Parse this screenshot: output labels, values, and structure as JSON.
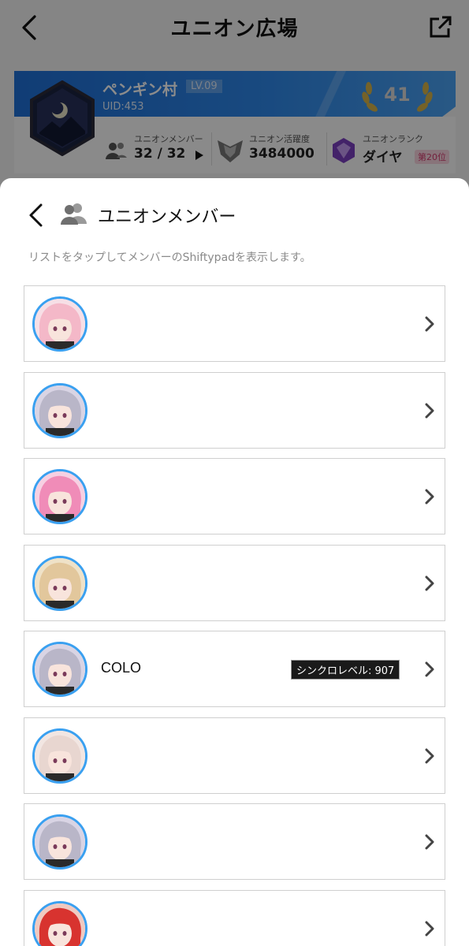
{
  "background_page": {
    "title": "ユニオン広場",
    "union": {
      "name": "ペンギン村",
      "level": "LV.09",
      "uid": "UID:453",
      "laurel_number": "41",
      "members_label": "ユニオンメンバー",
      "members_value": "32 / 32",
      "activity_label": "ユニオン活躍度",
      "activity_value": "3484000",
      "rank_label": "ユニオンランク",
      "rank_value": "ダイヤ",
      "rank_position": "第20位"
    }
  },
  "sheet": {
    "title": "ユニオンメンバー",
    "hint": "リストをタップしてメンバーのShiftypadを表示します。"
  },
  "members": [
    {
      "name": "",
      "sync": "",
      "avatar_hair": "#f4b8c8",
      "avatar_bg": "#f7dfe6"
    },
    {
      "name": "",
      "sync": "",
      "avatar_hair": "#b9b6c8",
      "avatar_bg": "#d9d4e4"
    },
    {
      "name": "",
      "sync": "",
      "avatar_hair": "#f08cb8",
      "avatar_bg": "#f7d0e2"
    },
    {
      "name": "",
      "sync": "",
      "avatar_hair": "#e2c79c",
      "avatar_bg": "#efe2c8"
    },
    {
      "name": "COLO",
      "sync": "シンクロレベル: 907",
      "avatar_hair": "#b9b6c8",
      "avatar_bg": "#d9d4e4"
    },
    {
      "name": "",
      "sync": "",
      "avatar_hair": "#e8d6d0",
      "avatar_bg": "#f2e6e2"
    },
    {
      "name": "",
      "sync": "",
      "avatar_hair": "#b9b6c8",
      "avatar_bg": "#d9d4e4"
    },
    {
      "name": "",
      "sync": "",
      "avatar_hair": "#d8332f",
      "avatar_bg": "#f0c9c0"
    }
  ],
  "colors": {
    "accent_blue": "#2d86e8",
    "avatar_ring": "#3aa0f0",
    "row_border": "#cfcfcf"
  }
}
